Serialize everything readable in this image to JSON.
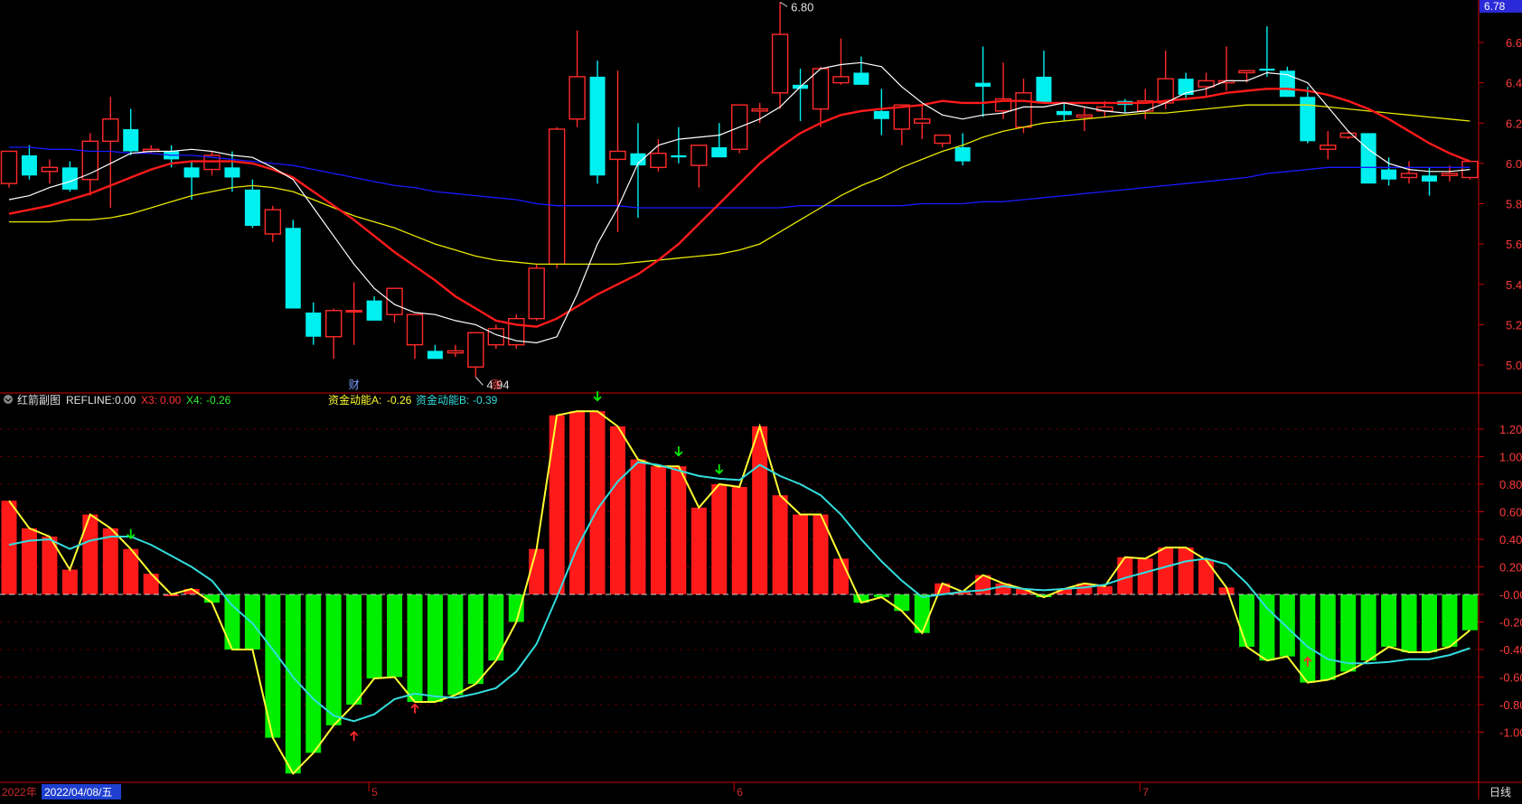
{
  "colors": {
    "background": "#000000",
    "up": "#ff2a2a",
    "down": "#00f0f0",
    "ma5": "#ffffff",
    "ma10": "#ff1a1a",
    "ma20": "#e8e800",
    "ma60": "#1a1aff",
    "bar_pos": "#ff1a1a",
    "bar_neg": "#00ee00",
    "line_a": "#ffff33",
    "line_b": "#33dddd",
    "axis": "#cc0000",
    "price_label": "#ff3b3b"
  },
  "main_chart": {
    "y_ticks": [
      "6.60",
      "6.40",
      "6.20",
      "6.00",
      "5.80",
      "5.60",
      "5.40",
      "5.20",
      "5.00"
    ],
    "current_price_badge": "6.78",
    "high_label": "6.80",
    "low_label": "4.94",
    "markers": {
      "cai": "财",
      "zhang": "涨"
    }
  },
  "indicator": {
    "name": "红箭副图",
    "refline_label": "REFLINE:",
    "refline_value": "0.00",
    "x3_label": "X3:",
    "x3_value": "0.00",
    "x4_label": "X4:",
    "x4_value": "-0.26",
    "a_label": "资金动能A:",
    "a_value": "-0.26",
    "b_label": "资金动能B:",
    "b_value": "-0.39",
    "y_ticks": [
      "1.20",
      "1.00",
      "0.80",
      "0.60",
      "0.40",
      "0.20",
      "-0.00",
      "-0.20",
      "-0.40",
      "-0.60",
      "-0.80",
      "-1.00"
    ]
  },
  "x_axis": {
    "year_label": "2022年",
    "cursor_date": "2022/04/08/五",
    "month_labels": [
      "5",
      "6",
      "7"
    ],
    "period_label": "日线"
  },
  "chart_data": [
    {
      "type": "candlestick",
      "ylim": [
        4.9,
        6.8
      ],
      "ohlc": [
        [
          5.9,
          6.06,
          5.88,
          6.06
        ],
        [
          6.04,
          6.09,
          5.92,
          5.94
        ],
        [
          5.96,
          6.02,
          5.9,
          5.98
        ],
        [
          5.98,
          6.01,
          5.86,
          5.87
        ],
        [
          5.92,
          6.15,
          5.84,
          6.11
        ],
        [
          6.11,
          6.33,
          5.78,
          6.22
        ],
        [
          6.17,
          6.27,
          6.04,
          6.06
        ],
        [
          6.06,
          6.09,
          6.05,
          6.07
        ],
        [
          6.06,
          6.09,
          5.98,
          6.02
        ],
        [
          5.98,
          6.01,
          5.82,
          5.93
        ],
        [
          5.97,
          6.06,
          5.94,
          6.04
        ],
        [
          5.98,
          6.06,
          5.86,
          5.93
        ],
        [
          5.87,
          5.92,
          5.68,
          5.69
        ],
        [
          5.65,
          5.79,
          5.61,
          5.77
        ],
        [
          5.68,
          5.72,
          5.3,
          5.28
        ],
        [
          5.26,
          5.31,
          5.1,
          5.14
        ],
        [
          5.14,
          5.28,
          5.03,
          5.27
        ],
        [
          5.27,
          5.41,
          5.1,
          5.27
        ],
        [
          5.32,
          5.34,
          5.24,
          5.22
        ],
        [
          5.25,
          5.38,
          5.21,
          5.38
        ],
        [
          5.1,
          5.25,
          5.03,
          5.25
        ],
        [
          5.07,
          5.1,
          5.04,
          5.03
        ],
        [
          5.06,
          5.1,
          5.04,
          5.07
        ],
        [
          4.99,
          5.15,
          4.94,
          5.16
        ],
        [
          5.1,
          5.2,
          5.08,
          5.18
        ],
        [
          5.1,
          5.25,
          5.08,
          5.23
        ],
        [
          5.23,
          5.5,
          5.22,
          5.48
        ],
        [
          5.5,
          6.18,
          5.48,
          6.17
        ],
        [
          6.22,
          6.66,
          6.18,
          6.43
        ],
        [
          6.43,
          6.51,
          5.9,
          5.94
        ],
        [
          6.02,
          6.46,
          5.66,
          6.06
        ],
        [
          6.05,
          6.2,
          5.73,
          5.99
        ],
        [
          5.98,
          6.12,
          5.96,
          6.05
        ],
        [
          6.04,
          6.18,
          6.0,
          6.03
        ],
        [
          5.99,
          6.09,
          5.88,
          6.09
        ],
        [
          6.08,
          6.2,
          6.04,
          6.03
        ],
        [
          6.07,
          6.29,
          6.05,
          6.29
        ],
        [
          6.26,
          6.3,
          6.2,
          6.27
        ],
        [
          6.35,
          6.8,
          6.27,
          6.64
        ],
        [
          6.39,
          6.47,
          6.21,
          6.37
        ],
        [
          6.27,
          6.48,
          6.18,
          6.47
        ],
        [
          6.4,
          6.62,
          6.39,
          6.43
        ],
        [
          6.45,
          6.53,
          6.4,
          6.39
        ],
        [
          6.26,
          6.37,
          6.14,
          6.22
        ],
        [
          6.17,
          6.29,
          6.09,
          6.29
        ],
        [
          6.2,
          6.29,
          6.12,
          6.22
        ],
        [
          6.1,
          6.14,
          6.08,
          6.14
        ],
        [
          6.08,
          6.15,
          5.99,
          6.01
        ],
        [
          6.4,
          6.58,
          6.23,
          6.38
        ],
        [
          6.26,
          6.5,
          6.22,
          6.32
        ],
        [
          6.18,
          6.42,
          6.15,
          6.35
        ],
        [
          6.43,
          6.56,
          6.31,
          6.3
        ],
        [
          6.26,
          6.3,
          6.21,
          6.24
        ],
        [
          6.23,
          6.28,
          6.16,
          6.24
        ],
        [
          6.26,
          6.31,
          6.23,
          6.28
        ],
        [
          6.31,
          6.32,
          6.25,
          6.29
        ],
        [
          6.26,
          6.37,
          6.22,
          6.31
        ],
        [
          6.3,
          6.56,
          6.27,
          6.42
        ],
        [
          6.42,
          6.45,
          6.32,
          6.34
        ],
        [
          6.38,
          6.45,
          6.33,
          6.41
        ],
        [
          6.4,
          6.58,
          6.36,
          6.41
        ],
        [
          6.45,
          6.46,
          6.4,
          6.46
        ],
        [
          6.47,
          6.68,
          6.43,
          6.46
        ],
        [
          6.46,
          6.48,
          6.33,
          6.33
        ],
        [
          6.33,
          6.38,
          6.1,
          6.11
        ],
        [
          6.07,
          6.16,
          6.02,
          6.09
        ],
        [
          6.13,
          6.16,
          6.12,
          6.15
        ],
        [
          6.15,
          6.15,
          5.9,
          5.9
        ],
        [
          5.97,
          6.03,
          5.89,
          5.92
        ],
        [
          5.93,
          6.01,
          5.9,
          5.95
        ],
        [
          5.94,
          5.98,
          5.84,
          5.91
        ],
        [
          5.94,
          5.99,
          5.91,
          5.95
        ],
        [
          5.93,
          6.01,
          5.92,
          6.01
        ]
      ],
      "ma5": [
        5.82,
        5.84,
        5.88,
        5.91,
        5.95,
        6.0,
        6.05,
        6.06,
        6.06,
        6.07,
        6.06,
        6.04,
        6.03,
        5.98,
        5.92,
        5.78,
        5.64,
        5.5,
        5.38,
        5.3,
        5.26,
        5.25,
        5.22,
        5.2,
        5.15,
        5.12,
        5.11,
        5.14,
        5.35,
        5.6,
        5.78,
        6.0,
        6.09,
        6.12,
        6.13,
        6.14,
        6.18,
        6.22,
        6.28,
        6.38,
        6.47,
        6.49,
        6.5,
        6.48,
        6.38,
        6.3,
        6.24,
        6.22,
        6.24,
        6.25,
        6.28,
        6.28,
        6.3,
        6.28,
        6.26,
        6.25,
        6.26,
        6.3,
        6.35,
        6.37,
        6.41,
        6.41,
        6.45,
        6.44,
        6.4,
        6.28,
        6.16,
        6.07,
        6.0,
        5.97,
        5.96,
        5.96,
        5.97
      ],
      "ma10": [
        5.75,
        5.77,
        5.79,
        5.82,
        5.85,
        5.89,
        5.93,
        5.97,
        6.0,
        6.01,
        6.01,
        6.01,
        6.0,
        5.97,
        5.93,
        5.86,
        5.79,
        5.72,
        5.64,
        5.56,
        5.49,
        5.42,
        5.34,
        5.28,
        5.22,
        5.2,
        5.19,
        5.23,
        5.29,
        5.35,
        5.4,
        5.45,
        5.52,
        5.6,
        5.7,
        5.8,
        5.9,
        6.0,
        6.08,
        6.15,
        6.2,
        6.24,
        6.26,
        6.27,
        6.28,
        6.29,
        6.31,
        6.3,
        6.3,
        6.31,
        6.31,
        6.3,
        6.3,
        6.3,
        6.3,
        6.3,
        6.3,
        6.31,
        6.32,
        6.33,
        6.35,
        6.36,
        6.37,
        6.37,
        6.36,
        6.34,
        6.31,
        6.27,
        6.22,
        6.16,
        6.1,
        6.05,
        6.01
      ],
      "ma20": [
        5.71,
        5.71,
        5.71,
        5.72,
        5.72,
        5.73,
        5.75,
        5.78,
        5.81,
        5.84,
        5.86,
        5.88,
        5.89,
        5.88,
        5.86,
        5.82,
        5.78,
        5.74,
        5.71,
        5.68,
        5.64,
        5.6,
        5.57,
        5.54,
        5.52,
        5.51,
        5.5,
        5.5,
        5.5,
        5.5,
        5.5,
        5.51,
        5.52,
        5.53,
        5.54,
        5.55,
        5.57,
        5.6,
        5.66,
        5.72,
        5.78,
        5.84,
        5.89,
        5.93,
        5.98,
        6.02,
        6.06,
        6.09,
        6.13,
        6.16,
        6.18,
        6.2,
        6.21,
        6.22,
        6.23,
        6.24,
        6.25,
        6.25,
        6.26,
        6.27,
        6.28,
        6.29,
        6.29,
        6.29,
        6.29,
        6.28,
        6.27,
        6.26,
        6.25,
        6.24,
        6.23,
        6.22,
        6.21
      ],
      "ma60": [
        6.08,
        6.08,
        6.07,
        6.07,
        6.06,
        6.06,
        6.05,
        6.05,
        6.04,
        6.04,
        6.03,
        6.02,
        6.01,
        6.0,
        5.99,
        5.97,
        5.95,
        5.93,
        5.91,
        5.89,
        5.88,
        5.86,
        5.85,
        5.84,
        5.83,
        5.82,
        5.8,
        5.79,
        5.79,
        5.79,
        5.79,
        5.78,
        5.78,
        5.78,
        5.78,
        5.78,
        5.78,
        5.78,
        5.78,
        5.79,
        5.79,
        5.79,
        5.79,
        5.79,
        5.79,
        5.8,
        5.8,
        5.8,
        5.81,
        5.81,
        5.82,
        5.83,
        5.84,
        5.85,
        5.86,
        5.87,
        5.88,
        5.89,
        5.9,
        5.91,
        5.92,
        5.93,
        5.95,
        5.96,
        5.97,
        5.98,
        5.98,
        5.98,
        5.98,
        5.98,
        5.98,
        5.98,
        5.98
      ]
    },
    {
      "type": "bar",
      "ylim": [
        -1.3,
        1.35
      ],
      "values": [
        0.68,
        0.48,
        0.42,
        0.18,
        0.58,
        0.48,
        0.33,
        0.15,
        0.0,
        0.04,
        -0.06,
        -0.4,
        -0.4,
        -1.04,
        -1.3,
        -1.15,
        -0.95,
        -0.8,
        -0.61,
        -0.6,
        -0.78,
        -0.78,
        -0.73,
        -0.65,
        -0.48,
        -0.2,
        0.33,
        1.3,
        1.33,
        1.33,
        1.22,
        0.98,
        0.93,
        0.93,
        0.63,
        0.8,
        0.78,
        1.22,
        0.72,
        0.58,
        0.58,
        0.26,
        -0.06,
        -0.02,
        -0.12,
        -0.28,
        0.08,
        0.02,
        0.14,
        0.08,
        0.04,
        -0.02,
        0.04,
        0.08,
        0.06,
        0.27,
        0.26,
        0.34,
        0.34,
        0.25,
        0.05,
        -0.38,
        -0.48,
        -0.45,
        -0.64,
        -0.62,
        -0.56,
        -0.48,
        -0.38,
        -0.42,
        -0.42,
        -0.38,
        -0.26
      ],
      "line_a": [
        0.68,
        0.48,
        0.42,
        0.18,
        0.58,
        0.48,
        0.33,
        0.15,
        0.0,
        0.04,
        -0.06,
        -0.4,
        -0.4,
        -1.04,
        -1.3,
        -1.15,
        -0.95,
        -0.8,
        -0.61,
        -0.6,
        -0.78,
        -0.78,
        -0.73,
        -0.65,
        -0.48,
        -0.2,
        0.33,
        1.3,
        1.33,
        1.33,
        1.22,
        0.98,
        0.93,
        0.93,
        0.63,
        0.8,
        0.78,
        1.22,
        0.72,
        0.58,
        0.58,
        0.26,
        -0.06,
        -0.02,
        -0.12,
        -0.28,
        0.08,
        0.02,
        0.14,
        0.08,
        0.04,
        -0.02,
        0.04,
        0.08,
        0.06,
        0.27,
        0.26,
        0.34,
        0.34,
        0.25,
        0.05,
        -0.38,
        -0.48,
        -0.45,
        -0.64,
        -0.62,
        -0.56,
        -0.48,
        -0.38,
        -0.42,
        -0.42,
        -0.38,
        -0.26
      ],
      "line_b": [
        0.36,
        0.39,
        0.4,
        0.33,
        0.39,
        0.42,
        0.42,
        0.36,
        0.28,
        0.2,
        0.1,
        -0.08,
        -0.21,
        -0.4,
        -0.6,
        -0.76,
        -0.88,
        -0.92,
        -0.87,
        -0.76,
        -0.72,
        -0.74,
        -0.75,
        -0.72,
        -0.68,
        -0.56,
        -0.36,
        -0.02,
        0.34,
        0.62,
        0.82,
        0.96,
        0.94,
        0.9,
        0.86,
        0.84,
        0.83,
        0.94,
        0.86,
        0.8,
        0.72,
        0.58,
        0.4,
        0.24,
        0.1,
        -0.02,
        0.0,
        0.02,
        0.03,
        0.06,
        0.04,
        0.03,
        0.04,
        0.05,
        0.07,
        0.12,
        0.16,
        0.2,
        0.24,
        0.26,
        0.22,
        0.08,
        -0.1,
        -0.24,
        -0.38,
        -0.47,
        -0.5,
        -0.5,
        -0.49,
        -0.47,
        -0.47,
        -0.44,
        -0.39
      ],
      "up_arrows": [
        17,
        20,
        64
      ],
      "down_arrows": [
        6,
        29,
        33,
        35
      ]
    }
  ]
}
